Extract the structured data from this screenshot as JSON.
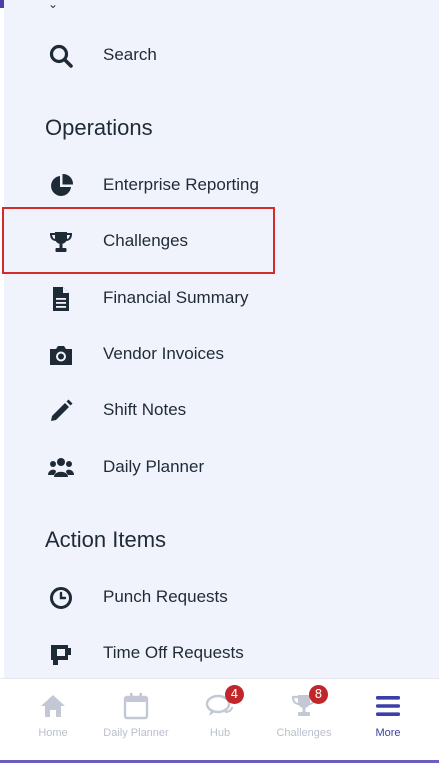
{
  "menu": {
    "top_item": {
      "label": "Search",
      "icon": "search-icon"
    },
    "sections": [
      {
        "title": "Operations",
        "items": [
          {
            "label": "Enterprise Reporting",
            "icon": "pie-chart-icon"
          },
          {
            "label": "Challenges",
            "icon": "trophy-icon"
          },
          {
            "label": "Financial Summary",
            "icon": "document-icon"
          },
          {
            "label": "Vendor Invoices",
            "icon": "camera-icon"
          },
          {
            "label": "Shift Notes",
            "icon": "pencil-icon"
          },
          {
            "label": "Daily Planner",
            "icon": "users-icon"
          }
        ]
      },
      {
        "title": "Action Items",
        "items": [
          {
            "label": "Punch Requests",
            "icon": "clock-icon"
          },
          {
            "label": "Time Off Requests",
            "icon": "beach-icon"
          }
        ]
      }
    ]
  },
  "tabbar": {
    "tabs": [
      {
        "label": "Home",
        "icon": "home-icon",
        "active": false
      },
      {
        "label": "Daily Planner",
        "icon": "calendar-icon",
        "active": false
      },
      {
        "label": "Hub",
        "icon": "chat-bubbles-icon",
        "badge": "4",
        "active": false
      },
      {
        "label": "Challenges",
        "icon": "trophy-icon",
        "badge": "8",
        "active": false
      },
      {
        "label": "More",
        "icon": "menu-icon",
        "active": true
      }
    ]
  },
  "colors": {
    "menu_background": "#f1f3fc",
    "text": "#1f2a37",
    "highlight_border": "#d62b2b",
    "badge": "#c0262a",
    "tab_inactive": "#b9bfcc",
    "tab_active": "#3b3fa7",
    "brand_bar": "#4b3fa8"
  }
}
